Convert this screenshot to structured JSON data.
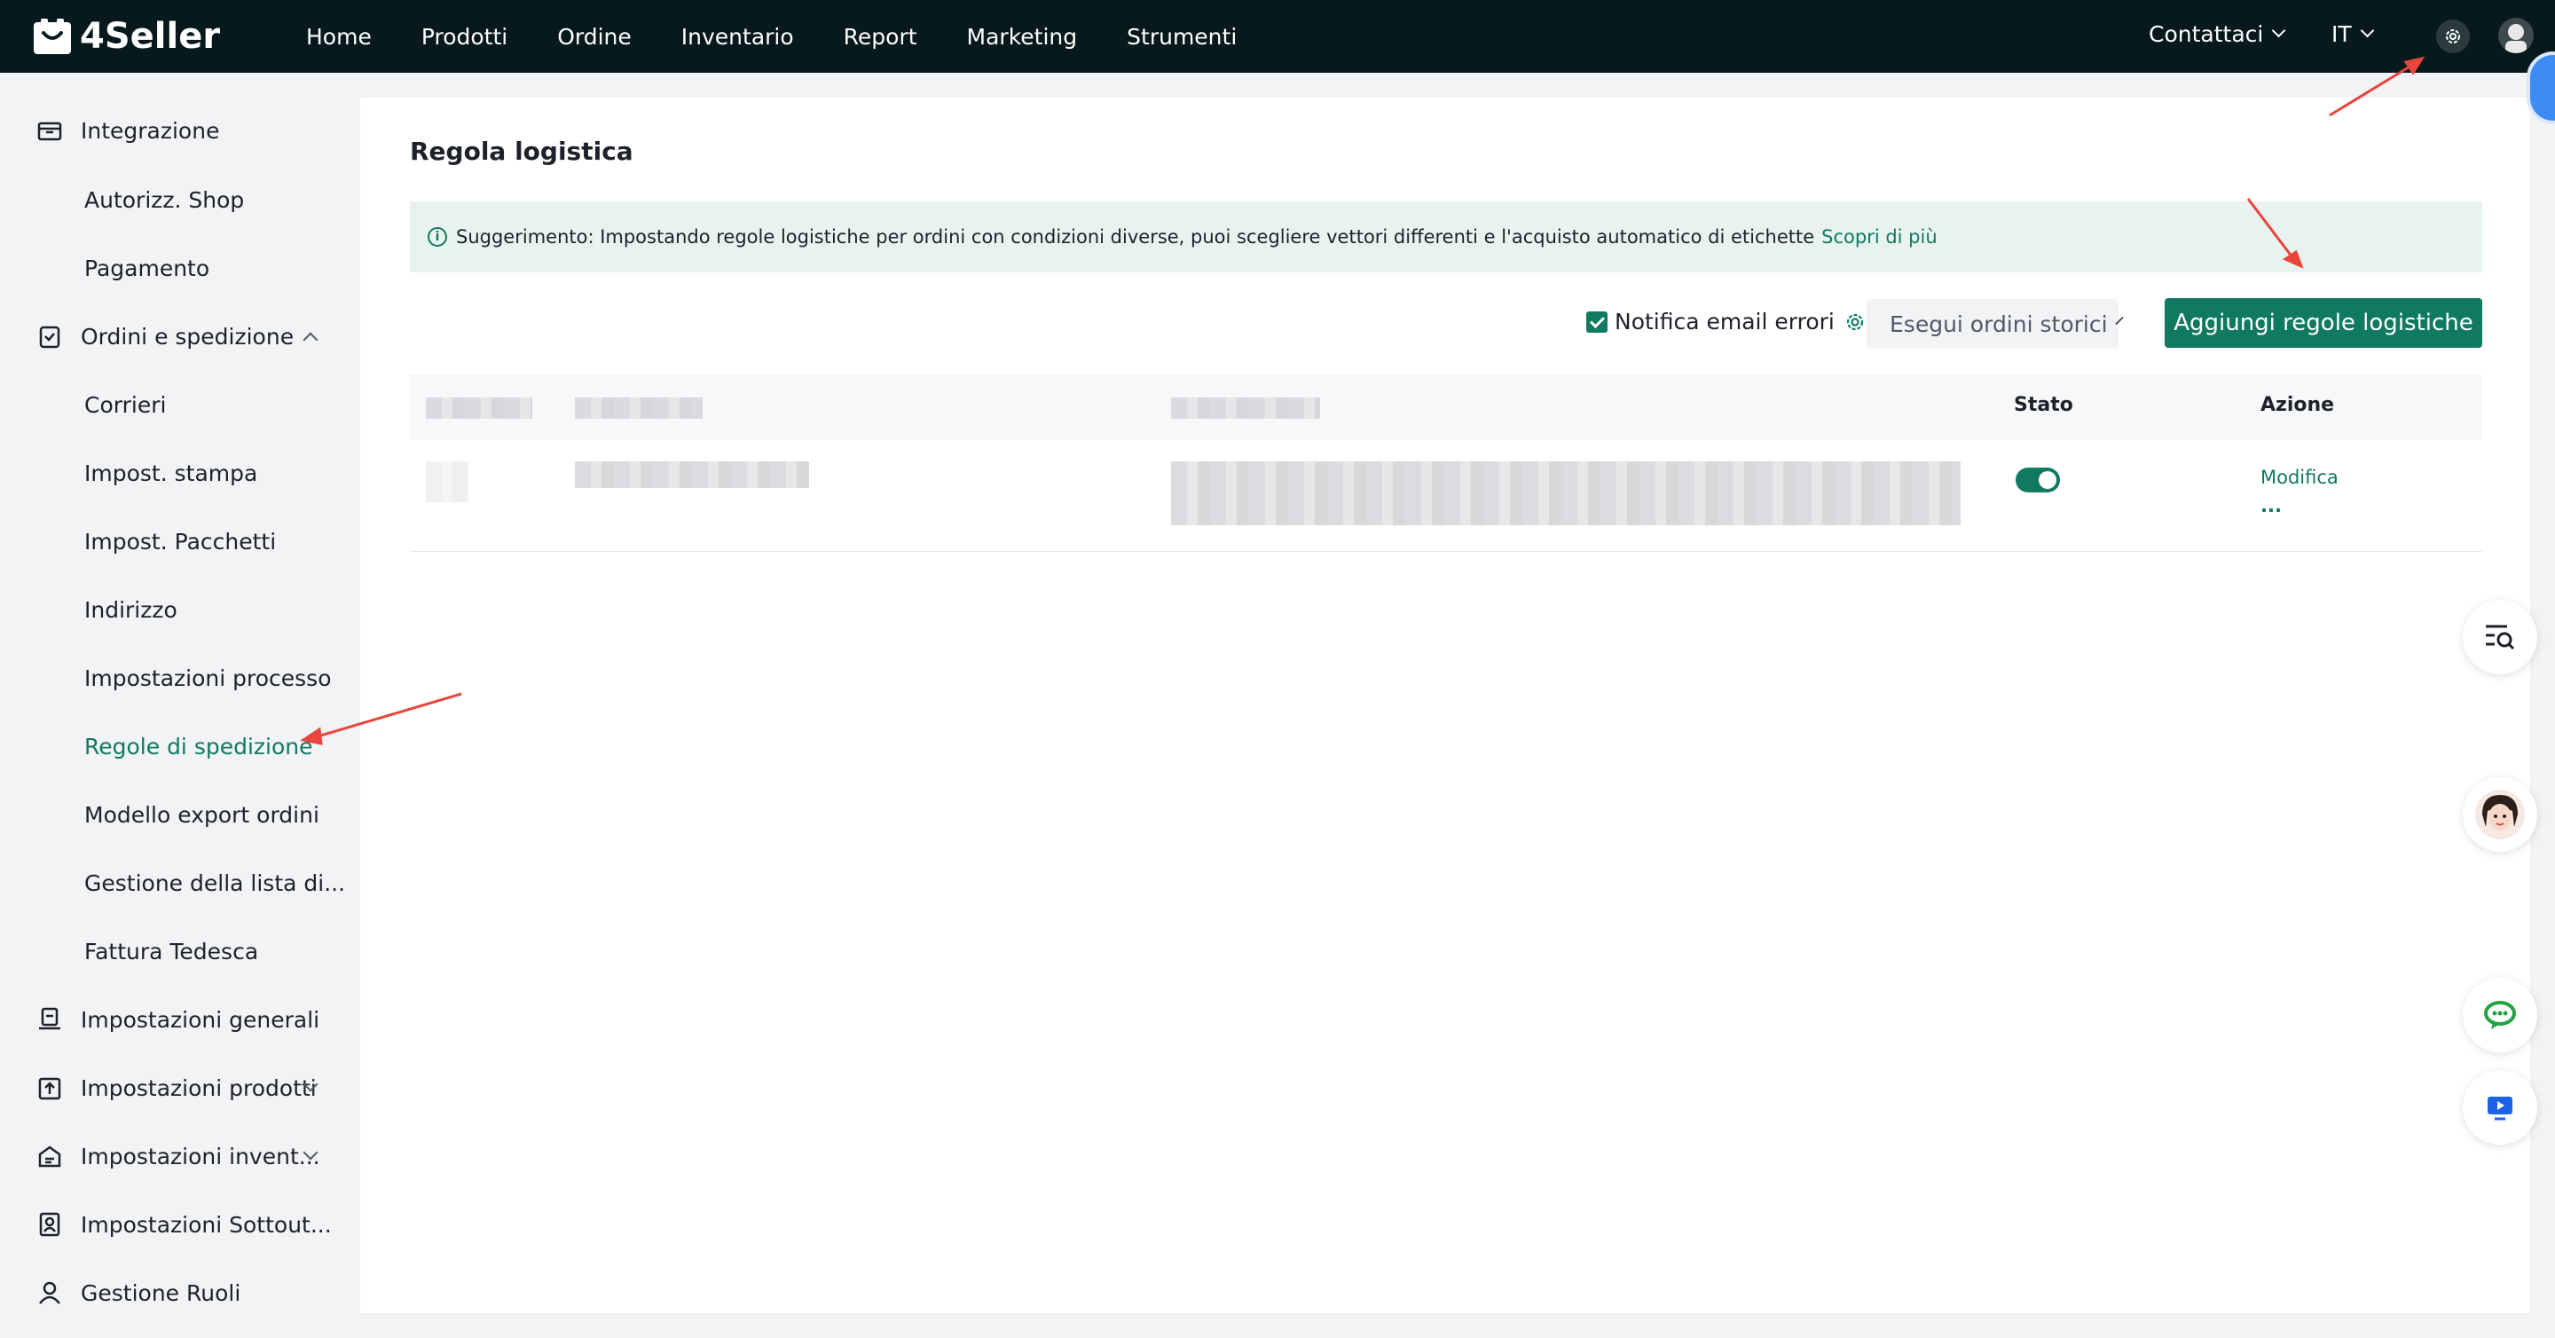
{
  "brand": {
    "name": "4Seller"
  },
  "nav": {
    "items": [
      "Home",
      "Prodotti",
      "Ordine",
      "Inventario",
      "Report",
      "Marketing",
      "Strumenti"
    ]
  },
  "top_right": {
    "contact": "Contattaci",
    "lang": "IT"
  },
  "sidebar": {
    "items": [
      {
        "label": "Integrazione",
        "icon": "store-icon"
      },
      {
        "label": "Autorizz. Shop"
      },
      {
        "label": "Pagamento"
      },
      {
        "label": "Ordini e spedizione",
        "icon": "clipboard-icon"
      },
      {
        "label": "Corrieri"
      },
      {
        "label": "Impost. stampa"
      },
      {
        "label": "Impost. Pacchetti"
      },
      {
        "label": "Indirizzo"
      },
      {
        "label": "Impostazioni processo"
      },
      {
        "label": "Regole di spedizione"
      },
      {
        "label": "Modello export ordini"
      },
      {
        "label": "Gestione della lista di..."
      },
      {
        "label": "Fattura Tedesca"
      },
      {
        "label": "Impostazioni generali",
        "icon": "printer-icon"
      },
      {
        "label": "Impostazioni prodotti",
        "icon": "box-upload-icon"
      },
      {
        "label": "Impostazioni invent...",
        "icon": "inventory-icon"
      },
      {
        "label": "Impostazioni Sottout...",
        "icon": "sub-account-icon"
      },
      {
        "label": "Gestione Ruoli",
        "icon": "user-icon"
      }
    ]
  },
  "page": {
    "title": "Regola logistica",
    "tip_text": "Suggerimento: Impostando regole logistiche per ordini con condizioni diverse, puoi scegliere vettori differenti e l'acquisto automatico di etichette",
    "tip_link": "Scopri di più",
    "email_notify": "Notifica email errori",
    "history_button": "Esegui ordini storici",
    "add_button": "Aggiungi regole logistiche"
  },
  "table": {
    "headers": {
      "status": "Stato",
      "action": "Azione"
    },
    "row": {
      "status_on": true,
      "edit": "Modifica",
      "more": "..."
    }
  },
  "colors": {
    "accent": "#0f7a60",
    "topbar": "#07191c",
    "tip_bg": "#e8f3ef"
  }
}
